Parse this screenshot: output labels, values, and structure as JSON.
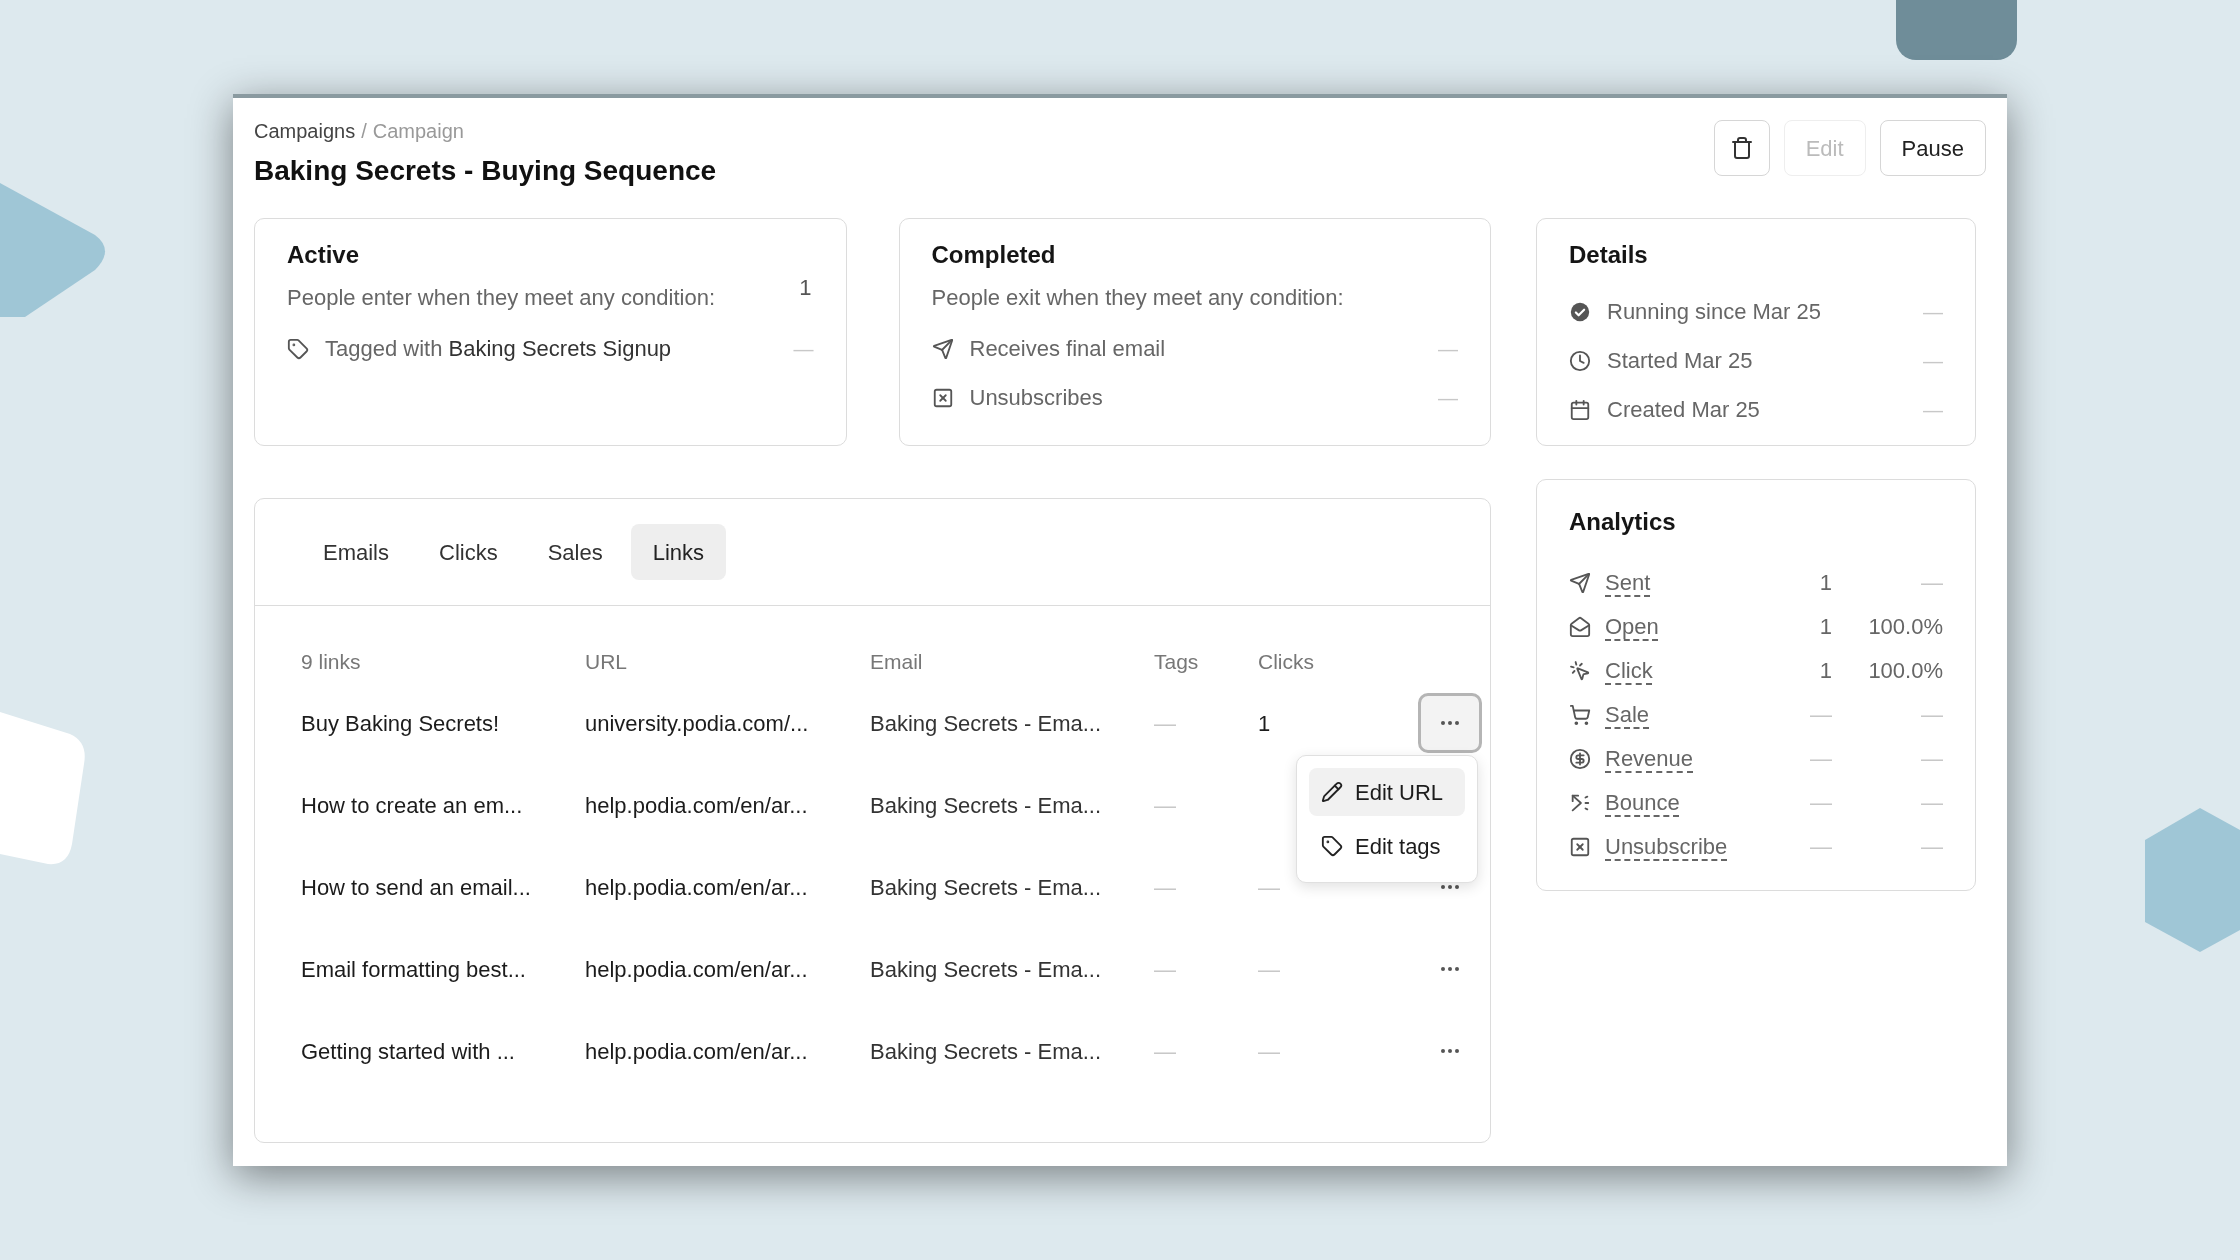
{
  "breadcrumb": [
    {
      "label": "Campaigns",
      "current": false
    },
    {
      "label": "Campaign",
      "current": true
    }
  ],
  "breadcrumb_separator": "/",
  "title": "Baking Secrets - Buying Sequence",
  "header_buttons": [
    {
      "kind": "delete",
      "disabled": false
    },
    {
      "kind": "text",
      "label": "Edit",
      "disabled": true
    },
    {
      "kind": "text",
      "label": "Pause",
      "disabled": false
    }
  ],
  "entry_card": {
    "title": "Active",
    "count": "1",
    "subtitle": "People enter when they meet any condition:",
    "conditions": [
      {
        "kind": "tag",
        "text": "Tagged with **Baking Secrets Signup**",
        "value": "—"
      }
    ]
  },
  "exit_card": {
    "title": "Completed",
    "subtitle": "People exit when they meet any condition:",
    "conditions": [
      {
        "kind": "email",
        "text": "Receives final email",
        "value": "—"
      },
      {
        "kind": "unsubscribe",
        "text": "Unsubscribes",
        "value": "—"
      }
    ]
  },
  "details": {
    "title": "Details",
    "items": [
      {
        "kind": "running",
        "text": "Running since Mar 25",
        "value": "—"
      },
      {
        "kind": "started",
        "text": "Started Mar 25",
        "value": "—"
      },
      {
        "kind": "created",
        "text": "Created Mar 25",
        "value": "—"
      }
    ]
  },
  "analytics": {
    "title": "Analytics",
    "rows": [
      {
        "kind": "sent",
        "label": "Sent",
        "count": "1",
        "rate": "—"
      },
      {
        "kind": "open",
        "label": "Open",
        "count": "1",
        "rate": "100.0%"
      },
      {
        "kind": "click",
        "label": "Click",
        "count": "1",
        "rate": "100.0%"
      },
      {
        "kind": "sale",
        "label": "Sale",
        "count": "—",
        "rate": "—"
      },
      {
        "kind": "revenue",
        "label": "Revenue",
        "count": "—",
        "rate": "—"
      },
      {
        "kind": "bounce",
        "label": "Bounce",
        "count": "—",
        "rate": "—"
      },
      {
        "kind": "unsubscribe",
        "label": "Unsubscribe",
        "count": "—",
        "rate": "—"
      }
    ]
  },
  "tabs": [
    {
      "label": "Emails",
      "selected": false
    },
    {
      "label": "Clicks",
      "selected": false
    },
    {
      "label": "Sales",
      "selected": false
    },
    {
      "label": "Links",
      "selected": true
    }
  ],
  "table": {
    "columns": [
      "9 links",
      "URL",
      "Email",
      "Tags",
      "Clicks"
    ],
    "rows": [
      {
        "name": "Buy Baking Secrets!",
        "url": "university.podia.com/...",
        "email": "Baking Secrets - Ema...",
        "tags": "—",
        "clicks": "1",
        "actions": true,
        "menu_open": true
      },
      {
        "name": "How to create an em...",
        "url": "help.podia.com/en/ar...",
        "email": "Baking Secrets - Ema...",
        "tags": "—",
        "actions": false
      },
      {
        "name": "How to send an email...",
        "url": "help.podia.com/en/ar...",
        "email": "Baking Secrets - Ema...",
        "tags": "—",
        "clicks": "—",
        "actions": true,
        "menu_open": false
      },
      {
        "name": "Email formatting best...",
        "url": "help.podia.com/en/ar...",
        "email": "Baking Secrets - Ema...",
        "tags": "—",
        "clicks": "—",
        "actions": true,
        "menu_open": false
      },
      {
        "name": "Getting started with ...",
        "url": "help.podia.com/en/ar...",
        "email": "Baking Secrets - Ema...",
        "tags": "—",
        "clicks": "—",
        "actions": true,
        "menu_open": false
      }
    ],
    "menu": [
      {
        "kind": "edit",
        "label": "Edit URL",
        "highlighted": true
      },
      {
        "kind": "tag",
        "label": "Edit tags",
        "highlighted": false
      }
    ]
  }
}
